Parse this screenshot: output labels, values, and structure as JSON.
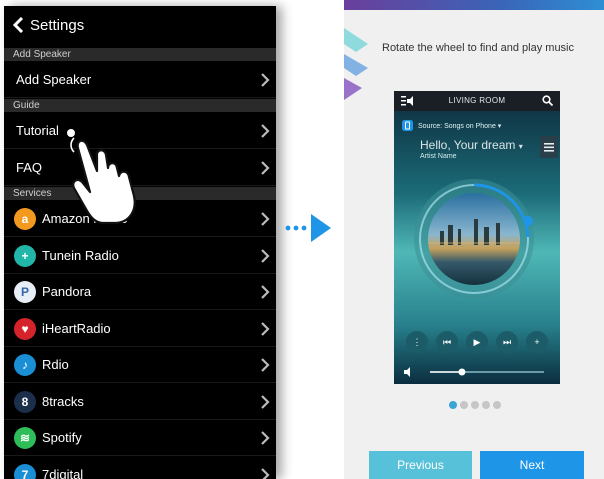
{
  "settings": {
    "title": "Settings",
    "sections": {
      "add_speaker_header": "Add Speaker",
      "guide_header": "Guide",
      "services_header": "Services"
    },
    "rows": {
      "add_speaker": "Add Speaker",
      "tutorial": "Tutorial",
      "faq": "FAQ"
    },
    "services": [
      {
        "label": "Amazon Music",
        "icon": "amazon-music-icon",
        "color": "#f39a1e",
        "glyph": "a"
      },
      {
        "label": "Tunein Radio",
        "icon": "tunein-radio-icon",
        "color": "#21b6a8",
        "glyph": "+"
      },
      {
        "label": "Pandora",
        "icon": "pandora-icon",
        "color": "#e8eef6",
        "glyph": "P"
      },
      {
        "label": "iHeartRadio",
        "icon": "iheartradio-icon",
        "color": "#d4232a",
        "glyph": "♥"
      },
      {
        "label": "Rdio",
        "icon": "rdio-icon",
        "color": "#1a8fd5",
        "glyph": "♪"
      },
      {
        "label": "8tracks",
        "icon": "8tracks-icon",
        "color": "#1b2f4a",
        "glyph": "8"
      },
      {
        "label": "Spotify",
        "icon": "spotify-icon",
        "color": "#2ebd59",
        "glyph": "≋"
      },
      {
        "label": "7digital",
        "icon": "7digital-icon",
        "color": "#1a8fd5",
        "glyph": "7"
      }
    ]
  },
  "tutorial": {
    "instruction": "Rotate the wheel to find and play music",
    "phone": {
      "room": "LIVING ROOM",
      "source": "Source: Songs on Phone",
      "song_title": "Hello, Your dream",
      "artist": "Artist Name",
      "volume_level": 0.28
    },
    "page_dots": {
      "count": 5,
      "active_index": 0
    },
    "buttons": {
      "previous": "Previous",
      "next": "Next"
    }
  },
  "colors": {
    "accent_blue": "#1e95e6",
    "prev_button": "#56c1d8",
    "arrow_blue": "#1e95e6"
  }
}
